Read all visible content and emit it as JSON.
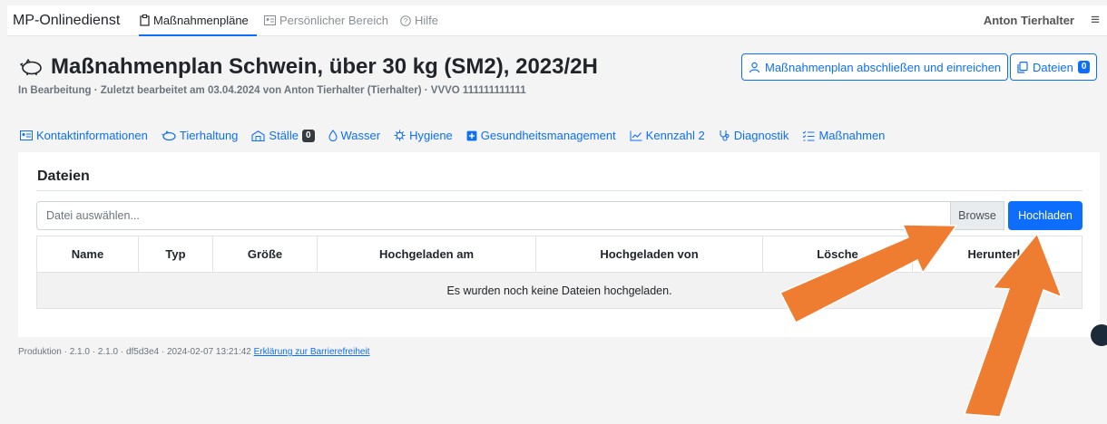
{
  "navbar": {
    "brand": "MP-Onlinedienst",
    "items": [
      {
        "label": "Maßnahmenpläne",
        "icon": "clipboard-icon"
      },
      {
        "label": "Persönlicher Bereich",
        "icon": "id-card-icon"
      },
      {
        "label": "Hilfe",
        "icon": "question-circle-icon"
      }
    ],
    "user": "Anton Tierhalter",
    "menu_icon": "hamburger-icon"
  },
  "header": {
    "title": "Maßnahmenplan Schwein, über 30 kg (SM2), 2023/2H",
    "title_icon": "pig-icon",
    "subtitle": "In Bearbeitung · Zuletzt bearbeitet am 03.04.2024 von Anton Tierhalter (Tierhalter) · VVVO 111111111111",
    "submit_label": "Maßnahmenplan abschließen und einreichen",
    "files_label": "Dateien",
    "files_count": "0"
  },
  "tabs": [
    {
      "label": "Kontaktinformationen",
      "icon": "contact-card-icon"
    },
    {
      "label": "Tierhaltung",
      "icon": "pig-icon"
    },
    {
      "label": "Ställe",
      "icon": "barn-icon",
      "badge": "0"
    },
    {
      "label": "Wasser",
      "icon": "droplet-icon"
    },
    {
      "label": "Hygiene",
      "icon": "virus-icon"
    },
    {
      "label": "Gesundheitsmanagement",
      "icon": "plus-square-icon"
    },
    {
      "label": "Kennzahl 2",
      "icon": "chart-line-icon"
    },
    {
      "label": "Diagnostik",
      "icon": "stethoscope-icon"
    },
    {
      "label": "Maßnahmen",
      "icon": "list-check-icon"
    }
  ],
  "files": {
    "title": "Dateien",
    "placeholder": "Datei auswählen...",
    "browse": "Browse",
    "upload": "Hochladen",
    "columns": [
      "Name",
      "Typ",
      "Größe",
      "Hochgeladen am",
      "Hochgeladen von",
      "Lösche",
      "Herunterla"
    ],
    "empty": "Es wurden noch keine Dateien hochgeladen."
  },
  "footer": {
    "text": "Produktion · 2.1.0 · 2.1.0 · df5d3e4 · 2024-02-07 13:21:42",
    "link": "Erklärung zur Barrierefreiheit"
  },
  "colors": {
    "accent": "#0d6efd",
    "arrow": "#ee7d31"
  }
}
